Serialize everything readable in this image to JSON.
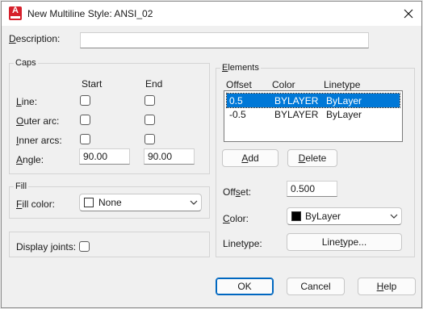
{
  "window": {
    "title": "New Multiline Style: ANSI_02",
    "close_icon": "close-icon",
    "app_icon": "autocad-icon"
  },
  "description": {
    "label": "Description:",
    "value": ""
  },
  "caps": {
    "title": "Caps",
    "col_start": "Start",
    "col_end": "End",
    "line_label": "Line:",
    "outer_arc_label": "Outer arc:",
    "inner_arcs_label": "Inner arcs:",
    "angle_label": "Angle:",
    "angle_start": "90.00",
    "angle_end": "90.00"
  },
  "fill": {
    "title": "Fill",
    "fill_color_label": "Fill color:",
    "fill_color_value": "None",
    "swatch_color": "#ffffff"
  },
  "display_joints_label": "Display joints:",
  "elements": {
    "title": "Elements",
    "headers": [
      "Offset",
      "Color",
      "Linetype"
    ],
    "rows": [
      {
        "offset": "0.5",
        "color": "BYLAYER",
        "linetype": "ByLayer"
      },
      {
        "offset": "-0.5",
        "color": "BYLAYER",
        "linetype": "ByLayer"
      }
    ],
    "add_label": "Add",
    "delete_label": "Delete",
    "offset_label": "Offset:",
    "offset_value": "0.500",
    "color_label": "Color:",
    "color_value": "ByLayer",
    "color_swatch": "#000000",
    "linetype_label": "Linetype:",
    "linetype_button": "Linetype..."
  },
  "buttons": {
    "ok": "OK",
    "cancel": "Cancel",
    "help": "Help"
  },
  "colors": {
    "selection": "#0078d7",
    "accent_border": "#0067c0",
    "app_red": "#d6202b"
  }
}
